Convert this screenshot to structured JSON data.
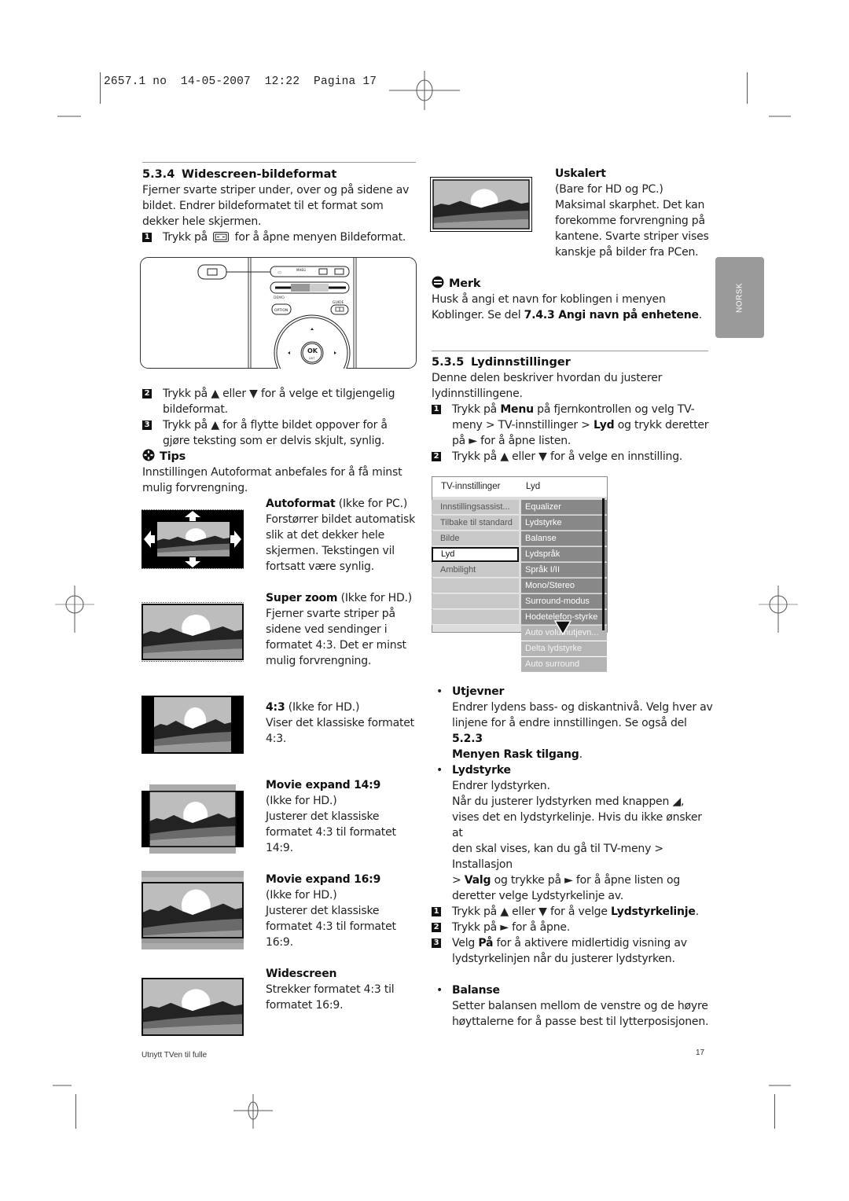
{
  "print_header": "2657.1 no  14-05-2007  12:22  Pagina 17",
  "section_534": {
    "number": "5.3.4",
    "title": "Widescreen-bildeformat",
    "intro_lines": [
      "Fjerner svarte striper under, over og på sidene av",
      "bildet. Endrer bildeformatet til et format som",
      "dekker hele skjermen."
    ],
    "step1": {
      "num": "1",
      "pre": "Trykk på",
      "icon": "format-button-icon",
      "post": "for å åpne menyen Bildeformat."
    },
    "remote": {
      "labels": [
        "DEMO",
        "GUIDE",
        "OPTION",
        "OK",
        "LIST"
      ]
    },
    "step2": {
      "num": "2",
      "line1": "Trykk på ▲ eller ▼ for å velge et tilgjengelig",
      "line2": "bildeformat."
    },
    "step3": {
      "num": "3",
      "line1": "Trykk på ▲ for å flytte bildet oppover for å",
      "line2": "gjøre teksting som er delvis skjult, synlig."
    },
    "tips": {
      "title": "Tips",
      "lines": [
        "Innstillingen Autoformat anbefales for å få minst",
        "mulig forvrengning."
      ]
    },
    "formats": [
      {
        "name": "Autoformat",
        "note": " (Ikke for PC.)",
        "lines": [
          "Forstørrer bildet automatisk",
          "slik at det dekker hele",
          "skjermen. Tekstingen vil",
          "fortsatt være synlig."
        ]
      },
      {
        "name": "Super zoom",
        "note": " (Ikke for HD.)",
        "lines": [
          "Fjerner svarte striper på",
          "sidene ved sendinger i",
          "formatet 4:3. Det er minst",
          "mulig forvrengning."
        ]
      },
      {
        "name": "4:3",
        "note": " (Ikke for HD.)",
        "lines": [
          "Viser det klassiske formatet",
          "4:3."
        ]
      },
      {
        "name": "Movie expand 14:9",
        "note": "",
        "lines": [
          "(Ikke for HD.)",
          "Justerer det klassiske",
          "formatet 4:3 til formatet",
          "14:9."
        ]
      },
      {
        "name": "Movie expand 16:9",
        "note": "",
        "lines": [
          "(Ikke for HD.)",
          "Justerer det klassiske",
          "formatet 4:3 til formatet",
          "16:9."
        ]
      },
      {
        "name": "Widescreen",
        "note": "",
        "lines": [
          "Strekker formatet 4:3 til",
          "formatet 16:9."
        ]
      },
      {
        "name": "Uskalert",
        "note": "",
        "lines": [
          "(Bare for HD og PC.)",
          "Maksimal skarphet. Det kan",
          "forekomme forvrengning på",
          "kantene. Svarte striper vises",
          "kanskje på bilder fra PCen."
        ]
      }
    ]
  },
  "note": {
    "title": "Merk",
    "line1": "Husk å angi et navn for koblingen i menyen",
    "line2_pre": "Koblinger. Se del ",
    "line2_bold": "7.4.3 Angi navn på enhetene",
    "line2_post": "."
  },
  "section_535": {
    "number": "5.3.5",
    "title": "Lydinnstillinger",
    "intro_lines": [
      "Denne delen beskriver hvordan du justerer",
      "lydinnstillingene."
    ],
    "step1": {
      "num": "1",
      "a": "Trykk på ",
      "b": "Menu",
      "c": " på fjernkontrollen og velg TV-",
      "d": "meny > TV-innstillinger > ",
      "e": "Lyd",
      "f": " og trykk deretter",
      "g": "på ► for å åpne listen."
    },
    "step2": {
      "num": "2",
      "text": "Trykk på ▲ eller ▼ for å velge en innstilling."
    }
  },
  "menu": {
    "header_left": "TV-innstillinger",
    "header_right": "Lyd",
    "left_items": [
      "Innstillingsassist...",
      "Tilbake til standard",
      "Bilde",
      "Lyd",
      "Ambilight",
      "",
      "",
      ""
    ],
    "selected_left": "Lyd",
    "right_items": [
      "Equalizer",
      "Lydstyrke",
      "Balanse",
      "Lydspråk",
      "Språk I/II",
      "Mono/Stereo",
      "Surround-modus",
      "Hodetelefon-styrke",
      "Auto volumutjevn...",
      "Delta lydstyrke",
      "Auto surround"
    ]
  },
  "bullets": {
    "utjevner": {
      "title": "Utjevner",
      "l1": "Endrer lydens bass- og diskantnivå. Velg hver av",
      "l2_pre": "linjene for å endre innstillingen. Se også del ",
      "l2_bold": "5.2.3",
      "l3_bold": "Menyen Rask tilgang",
      "l3_post": "."
    },
    "lydstyrke": {
      "title": "Lydstyrke",
      "l1": "Endrer lydstyrken.",
      "l2": "Når du justerer lydstyrken med knappen ◢,",
      "l3": "vises det en lydstyrkelinje. Hvis du ikke ønsker at",
      "l4": "den skal vises, kan du gå til TV-meny > Installasjon",
      "l5_pre": "> ",
      "l5_bold": "Valg",
      "l5_post": " og trykke på ► for å åpne listen og",
      "l6": "deretter velge Lydstyrkelinje av.",
      "s1_num": "1",
      "s1_pre": "Trykk på ▲ eller ▼ for å velge ",
      "s1_bold": "Lydstyrkelinje",
      "s1_post": ".",
      "s2_num": "2",
      "s2": "Trykk på ► for å åpne.",
      "s3_num": "3",
      "s3_pre": "Velg ",
      "s3_bold": "På",
      "s3_post": " for å aktivere midlertidig visning av",
      "s3_l2": "lydstyrkelinjen når du justerer lydstyrken."
    },
    "balanse": {
      "title": "Balanse",
      "l1": "Setter balansen mellom de venstre og de høyre",
      "l2": "høyttalerne for å passe best til lytterposisjonen."
    }
  },
  "side_tab": "NORSK",
  "footer": {
    "left": "Utnytt TVen til fulle",
    "page": "17"
  }
}
